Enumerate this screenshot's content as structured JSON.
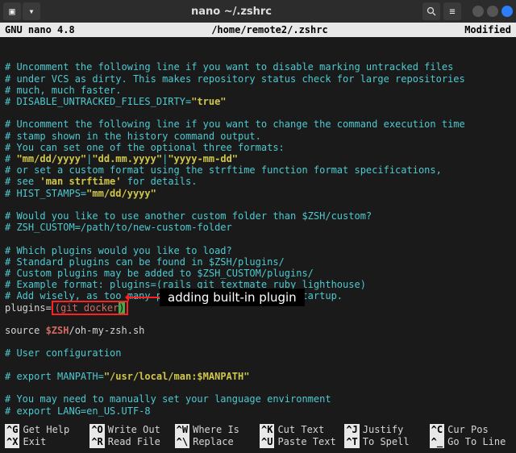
{
  "titlebar": {
    "title": "nano ~/.zshrc",
    "icon_left1": "folder-icon",
    "icon_left2": "chevron-down-icon",
    "icon_search": "search-icon",
    "icon_menu": "menu-icon"
  },
  "status": {
    "left": "GNU nano 4.8",
    "center": "/home/remote2/.zshrc",
    "right": "Modified"
  },
  "lines": [
    {
      "t": "c",
      "s": "# Uncomment the following line if you want to disable marking untracked files"
    },
    {
      "t": "c",
      "s": "# under VCS as dirty. This makes repository status check for large repositories"
    },
    {
      "t": "c",
      "s": "# much, much faster."
    },
    {
      "t": "mix",
      "parts": [
        {
          "c": "c",
          "s": "# DISABLE_UNTRACKED_FILES_DIRTY="
        },
        {
          "c": "y",
          "s": "\"true\""
        }
      ]
    },
    {
      "t": "blank"
    },
    {
      "t": "c",
      "s": "# Uncomment the following line if you want to change the command execution time"
    },
    {
      "t": "c",
      "s": "# stamp shown in the history command output."
    },
    {
      "t": "c",
      "s": "# You can set one of the optional three formats:"
    },
    {
      "t": "mix",
      "parts": [
        {
          "c": "c",
          "s": "# "
        },
        {
          "c": "y",
          "s": "\"mm/dd/yyyy\""
        },
        {
          "c": "c",
          "s": "|"
        },
        {
          "c": "y",
          "s": "\"dd.mm.yyyy\""
        },
        {
          "c": "c",
          "s": "|"
        },
        {
          "c": "y",
          "s": "\"yyyy-mm-dd\""
        }
      ]
    },
    {
      "t": "c",
      "s": "# or set a custom format using the strftime function format specifications,"
    },
    {
      "t": "mix",
      "parts": [
        {
          "c": "c",
          "s": "# see "
        },
        {
          "c": "y",
          "s": "'man strftime'"
        },
        {
          "c": "c",
          "s": " for details."
        }
      ]
    },
    {
      "t": "mix",
      "parts": [
        {
          "c": "c",
          "s": "# HIST_STAMPS="
        },
        {
          "c": "y",
          "s": "\"mm/dd/yyyy\""
        }
      ]
    },
    {
      "t": "blank"
    },
    {
      "t": "c",
      "s": "# Would you like to use another custom folder than $ZSH/custom?"
    },
    {
      "t": "c",
      "s": "# ZSH_CUSTOM=/path/to/new-custom-folder"
    },
    {
      "t": "blank"
    },
    {
      "t": "c",
      "s": "# Which plugins would you like to load?"
    },
    {
      "t": "c",
      "s": "# Standard plugins can be found in $ZSH/plugins/"
    },
    {
      "t": "c",
      "s": "# Custom plugins may be added to $ZSH_CUSTOM/plugins/"
    },
    {
      "t": "c",
      "s": "# Example format: plugins=(rails git textmate ruby lighthouse)"
    },
    {
      "t": "c",
      "s": "# Add wisely, as too many plugins slow down shell startup."
    },
    {
      "t": "plugins",
      "pre": "plugins=",
      "box": "(git docker",
      "cursor": ")"
    },
    {
      "t": "blank"
    },
    {
      "t": "mix",
      "parts": [
        {
          "c": "w",
          "s": "source "
        },
        {
          "c": "r",
          "s": "$ZSH"
        },
        {
          "c": "w",
          "s": "/oh-my-zsh.sh"
        }
      ]
    },
    {
      "t": "blank"
    },
    {
      "t": "c",
      "s": "# User configuration"
    },
    {
      "t": "blank"
    },
    {
      "t": "mix",
      "parts": [
        {
          "c": "c",
          "s": "# export MANPATH="
        },
        {
          "c": "y",
          "s": "\"/usr/local/man:$MANPATH\""
        }
      ]
    },
    {
      "t": "blank"
    },
    {
      "t": "c",
      "s": "# You may need to manually set your language environment"
    },
    {
      "t": "c",
      "s": "# export LANG=en_US.UTF-8"
    },
    {
      "t": "blank"
    }
  ],
  "annotation": "adding built-in plugin",
  "shortcuts": [
    {
      "k": "^G",
      "l": "Get Help"
    },
    {
      "k": "^O",
      "l": "Write Out"
    },
    {
      "k": "^W",
      "l": "Where Is"
    },
    {
      "k": "^K",
      "l": "Cut Text"
    },
    {
      "k": "^J",
      "l": "Justify"
    },
    {
      "k": "^C",
      "l": "Cur Pos"
    },
    {
      "k": "^X",
      "l": "Exit"
    },
    {
      "k": "^R",
      "l": "Read File"
    },
    {
      "k": "^\\",
      "l": "Replace"
    },
    {
      "k": "^U",
      "l": "Paste Text"
    },
    {
      "k": "^T",
      "l": "To Spell"
    },
    {
      "k": "^_",
      "l": "Go To Line"
    }
  ]
}
